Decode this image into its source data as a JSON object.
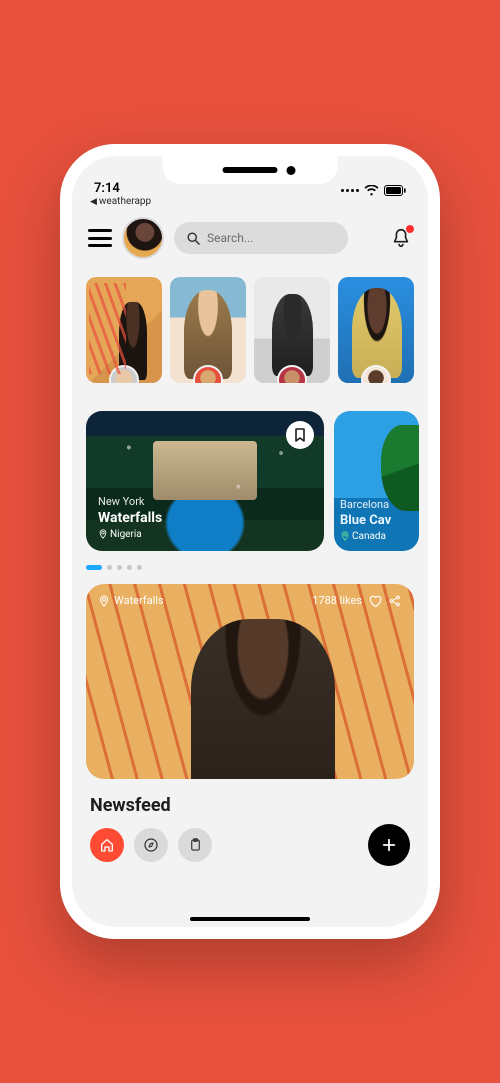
{
  "status": {
    "time": "7:14",
    "back_app": "weatherapp"
  },
  "search": {
    "placeholder": "Search..."
  },
  "stories": [
    {
      "id": "story-1"
    },
    {
      "id": "story-2"
    },
    {
      "id": "story-3"
    },
    {
      "id": "story-4"
    }
  ],
  "destinations": [
    {
      "city": "New York",
      "name": "Waterfalls",
      "country": "Nigeria"
    },
    {
      "city": "Barcelona",
      "name": "Blue Cav",
      "country": "Canada"
    }
  ],
  "carousel": {
    "count": 5,
    "active": 0
  },
  "feed": {
    "location": "Waterfalls",
    "likes_text": "1788  likes"
  },
  "newsfeed": {
    "title": "Newsfeed"
  }
}
